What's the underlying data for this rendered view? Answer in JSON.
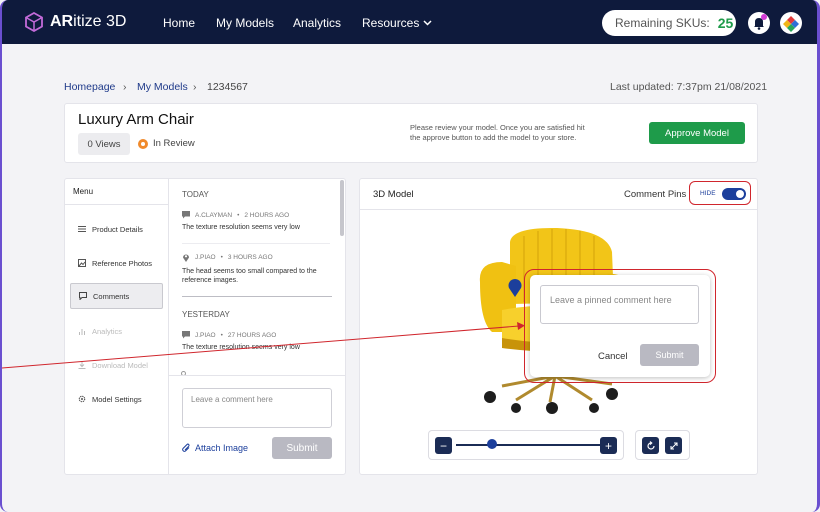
{
  "brand": {
    "name_bold": "AR",
    "name_rest": "itize 3D"
  },
  "nav": {
    "home": "Home",
    "my_models": "My Models",
    "analytics": "Analytics",
    "resources": "Resources"
  },
  "skus": {
    "label": "Remaining SKUs:",
    "count": "25"
  },
  "breadcrumb": {
    "home": "Homepage",
    "models": "My Models",
    "id": "1234567"
  },
  "last_updated": "Last updated: 7:37pm  21/08/2021",
  "product": {
    "title": "Luxury Arm Chair",
    "views": "0 Views",
    "status": "In Review",
    "review_note_line1": "Please review your model. Once you are satisfied hit",
    "review_note_line2": "the approve button to add the model to your store.",
    "approve_label": "Approve Model"
  },
  "menu": {
    "title": "Menu",
    "items": [
      {
        "label": "Product Details"
      },
      {
        "label": "Reference Photos"
      },
      {
        "label": "Comments"
      },
      {
        "label": "Analytics"
      },
      {
        "label": "Download Model"
      },
      {
        "label": "Model Settings"
      }
    ]
  },
  "comments": {
    "today": "TODAY",
    "yesterday": "YESTERDAY",
    "items": [
      {
        "author": "A.CLAYMAN",
        "time": "2 HOURS AGO",
        "text": "The texture resolution seems very low"
      },
      {
        "author": "J.PIAO",
        "time": "3 HOURS AGO",
        "text": "The head seems too small compared to the reference images."
      },
      {
        "author": "J.PIAO",
        "time": "27 HOURS AGO",
        "text": "The texture resolution seems very low"
      }
    ],
    "input_placeholder": "Leave a comment here",
    "attach_label": "Attach Image",
    "submit_label": "Submit"
  },
  "viewer": {
    "title": "3D Model",
    "pins_label": "Comment Pins",
    "toggle_label": "HIDE",
    "pin_placeholder": "Leave a pinned comment here",
    "cancel_label": "Cancel",
    "pin_submit_label": "Submit",
    "zoom_fraction": 0.25
  },
  "colors": {
    "accent": "#1e9b4a",
    "navy": "#0e1a3c",
    "annotation_red": "#d0262d",
    "chair_yellow": "#f2c518"
  }
}
